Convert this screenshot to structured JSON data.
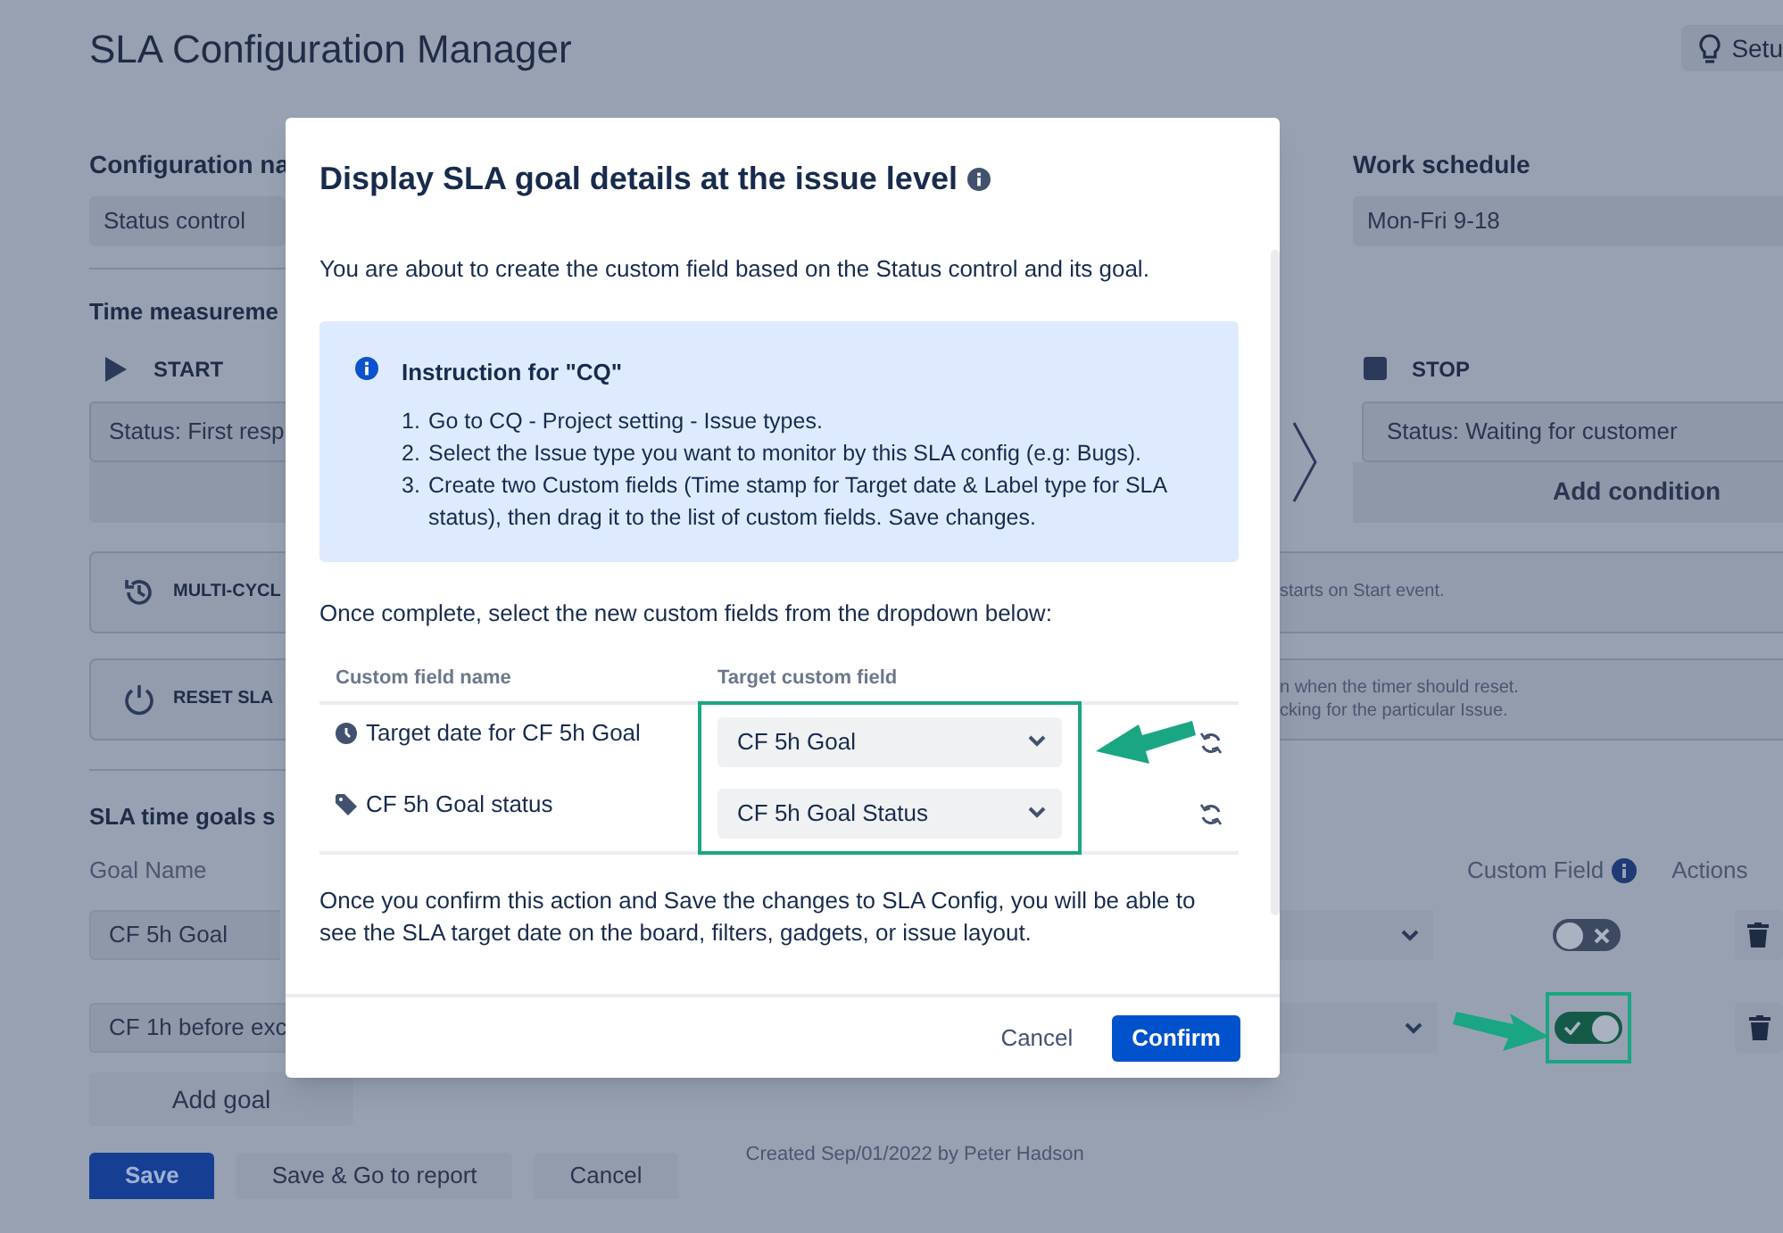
{
  "page": {
    "title": "SLA Configuration Manager",
    "setup_button": "Setu"
  },
  "config": {
    "name_label": "Configuration na",
    "name_value": "Status control",
    "schedule_label": "Work schedule",
    "schedule_value": "Mon-Fri 9-18"
  },
  "time_measurement": {
    "heading": "Time measureme",
    "start": {
      "label": "START",
      "condition": "Status: First resp"
    },
    "stop": {
      "label": "STOP",
      "condition": "Status: Waiting for customer",
      "add_button": "Add condition"
    }
  },
  "options": [
    {
      "kind": "multi_cycle",
      "label": "MULTI-CYCL",
      "description": [
        "starts on Start event."
      ]
    },
    {
      "kind": "reset",
      "label": "RESET SLA",
      "description": [
        "n when the timer should reset.",
        "cking for the particular Issue."
      ]
    }
  ],
  "goals": {
    "heading": "SLA time goals s",
    "columns": {
      "goal_name": "Goal Name",
      "custom_field": "Custom Field",
      "actions": "Actions"
    },
    "rows": [
      {
        "name": "CF 5h Goal",
        "custom_field_on": false,
        "highlighted": false
      },
      {
        "name": "CF 1h before exc",
        "custom_field_on": true,
        "highlighted": true
      }
    ],
    "add_button": "Add goal"
  },
  "footer": {
    "buttons": [
      {
        "label": "Save",
        "kind": "primary"
      },
      {
        "label": "Save & Go to report",
        "kind": "secondary"
      },
      {
        "label": "Cancel",
        "kind": "secondary"
      }
    ],
    "created": "Created Sep/01/2022 by Peter Hadson"
  },
  "dialog": {
    "title": "Display SLA goal details at the issue level",
    "intro": "You are about to create the custom field based on the Status control and its goal.",
    "instruction": {
      "title": "Instruction for \"CQ\"",
      "steps": [
        {
          "number": "1.",
          "text": "Go to CQ - Project setting - Issue types."
        },
        {
          "number": "2.",
          "text": "Select the Issue type you want to monitor by this SLA config (e.g: Bugs)."
        },
        {
          "number": "3.",
          "text": "Create two Custom fields (Time stamp for Target date & Label type for SLA status), then drag it to the list of custom fields. Save changes."
        }
      ]
    },
    "prompt": "Once complete, select the new custom fields from the dropdown below:",
    "table": {
      "columns": [
        "Custom field name",
        "Target custom field"
      ],
      "highlighted": true,
      "rows": [
        {
          "kind": "clock",
          "name": "Target date for CF 5h Goal",
          "target": "CF 5h Goal"
        },
        {
          "kind": "tag",
          "name": "CF 5h Goal status",
          "target": "CF 5h Goal Status"
        }
      ]
    },
    "note": "Once you confirm this action and Save the changes to SLA Config, you will be able to see the SLA target date on the board, filters, gadgets, or issue layout.",
    "cancel_button": "Cancel",
    "confirm_button": "Confirm"
  }
}
